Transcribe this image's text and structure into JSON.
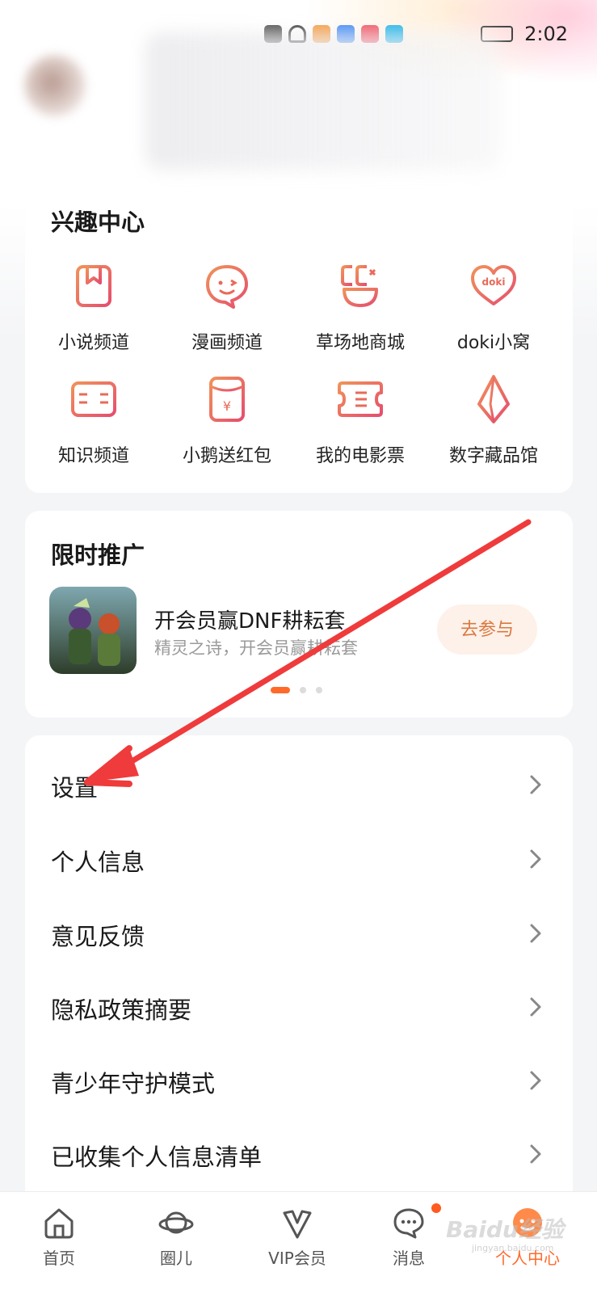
{
  "status_bar": {
    "time": "2:02"
  },
  "interest_center": {
    "title": "兴趣中心",
    "items": [
      {
        "label": "小说频道",
        "icon": "book-icon"
      },
      {
        "label": "漫画频道",
        "icon": "comic-face-icon"
      },
      {
        "label": "草场地商城",
        "icon": "cc-shop-icon"
      },
      {
        "label": "doki小窝",
        "icon": "doki-heart-icon",
        "icon_text": "doki"
      },
      {
        "label": "知识频道",
        "icon": "open-book-icon"
      },
      {
        "label": "小鹅送红包",
        "icon": "red-envelope-icon",
        "icon_text": "¥"
      },
      {
        "label": "我的电影票",
        "icon": "ticket-icon"
      },
      {
        "label": "数字藏品馆",
        "icon": "crystal-icon"
      }
    ]
  },
  "promo": {
    "title": "限时推广",
    "item_title": "开会员赢DNF耕耘套",
    "item_subtitle": "精灵之诗，开会员赢耕耘套",
    "button": "去参与",
    "active_page": 1,
    "page_count": 3
  },
  "menu": {
    "items": [
      {
        "label": "设置"
      },
      {
        "label": "个人信息"
      },
      {
        "label": "意见反馈"
      },
      {
        "label": "隐私政策摘要"
      },
      {
        "label": "青少年守护模式"
      },
      {
        "label": "已收集个人信息清单"
      }
    ]
  },
  "bottom_nav": {
    "items": [
      {
        "label": "首页",
        "icon": "home-icon"
      },
      {
        "label": "圈儿",
        "icon": "planet-icon"
      },
      {
        "label": "VIP会员",
        "icon": "vip-icon"
      },
      {
        "label": "消息",
        "icon": "message-icon",
        "badge": true
      },
      {
        "label": "个人中心",
        "icon": "profile-icon",
        "active": true
      }
    ]
  },
  "watermark": {
    "text": "Baidu经验",
    "subtext": "jingyan.baidu.com"
  },
  "colors": {
    "accent": "#ff6a2b",
    "icon_gradient_start": "#e8845a",
    "icon_gradient_end": "#e84f6a",
    "annotation_arrow": "#ef3b3b"
  }
}
